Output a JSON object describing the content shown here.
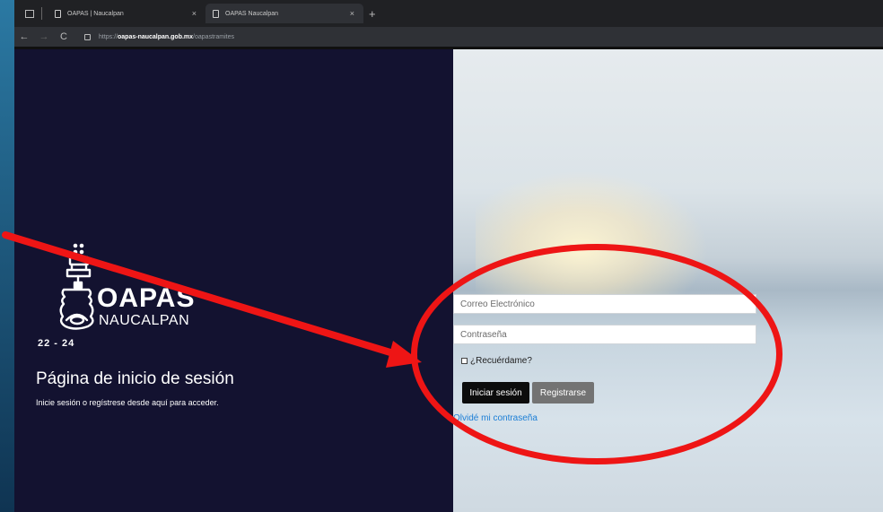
{
  "browser": {
    "tabs": [
      {
        "title": "OAPAS | Naucalpan",
        "close": "×"
      },
      {
        "title": "OAPAS Naucalpan",
        "close": "×"
      }
    ],
    "new_tab": "+",
    "nav": {
      "back": "←",
      "forward": "→",
      "reload": "C"
    },
    "url": {
      "scheme": "https://",
      "domain": "oapas-naucalpan.gob.mx",
      "path": "/oapastramites"
    }
  },
  "logo": {
    "word": "OAPAS",
    "sub": "NAUCALPAN",
    "years": "22 - 24"
  },
  "left": {
    "heading": "Página de inicio de sesión",
    "subheading": "Inicie sesión o regístrese desde aquí para acceder."
  },
  "form": {
    "email_placeholder": "Correo Electrónico",
    "password_placeholder": "Contraseña",
    "remember_label": "¿Recuérdame?",
    "login_label": "Iniciar sesión",
    "register_label": "Registrarse",
    "forgot_label": "Olvidé mi contraseña"
  },
  "colors": {
    "left_panel": "#131230",
    "annotation": "#ee1515",
    "link": "#1b7ed6"
  }
}
